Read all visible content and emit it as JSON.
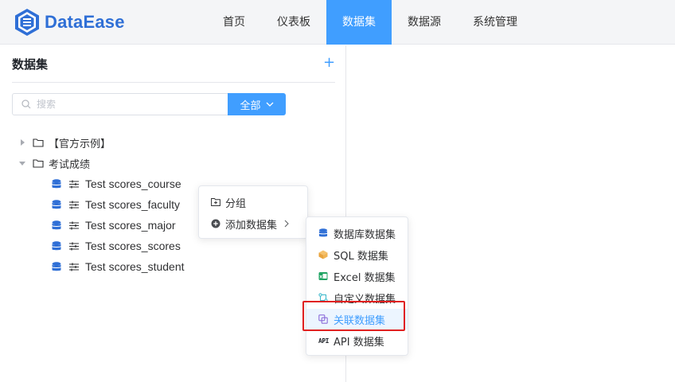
{
  "app": {
    "name": "DataEase"
  },
  "nav": [
    {
      "label": "首页",
      "active": false
    },
    {
      "label": "仪表板",
      "active": false
    },
    {
      "label": "数据集",
      "active": true
    },
    {
      "label": "数据源",
      "active": false
    },
    {
      "label": "系统管理",
      "active": false
    }
  ],
  "sidebar": {
    "title": "数据集",
    "add_symbol": "+",
    "search_placeholder": "搜索",
    "filter_label": "全部"
  },
  "tree": {
    "folders": [
      {
        "label": "【官方示例】",
        "expanded": false
      },
      {
        "label": "考试成绩",
        "expanded": true
      }
    ],
    "items": [
      "Test scores_course",
      "Test scores_faculty",
      "Test scores_major",
      "Test scores_scores",
      "Test scores_student"
    ]
  },
  "context_menu": {
    "items": [
      {
        "label": "分组",
        "icon": "folder-add-icon"
      },
      {
        "label": "添加数据集",
        "icon": "plus-circle-icon"
      }
    ]
  },
  "submenu": {
    "items": [
      {
        "label": "数据库数据集",
        "icon": "database-icon"
      },
      {
        "label": "SQL 数据集",
        "icon": "sql-cube-icon"
      },
      {
        "label": "Excel 数据集",
        "icon": "excel-icon"
      },
      {
        "label": "自定义数据集",
        "icon": "custom-icon"
      },
      {
        "label": "关联数据集",
        "icon": "union-icon",
        "highlighted": true
      },
      {
        "label": "API 数据集",
        "icon": "api-icon"
      }
    ],
    "api_icon_text": "API"
  },
  "colors": {
    "primary": "#409eff",
    "logo": "#2f6fd6",
    "highlight_border": "#e02020"
  }
}
